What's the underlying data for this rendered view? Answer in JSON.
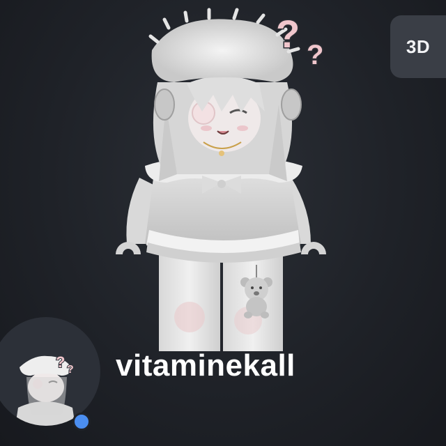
{
  "toolbar": {
    "view_mode_label": "3D"
  },
  "profile": {
    "username": "vitaminekall",
    "status": "online",
    "avatar_icon": "avatar-headshot-icon",
    "status_color": "#4b8ef0"
  },
  "avatar_scene": {
    "character_icon": "avatar-3d-character",
    "decoration_icon": "question-marks-icon"
  }
}
